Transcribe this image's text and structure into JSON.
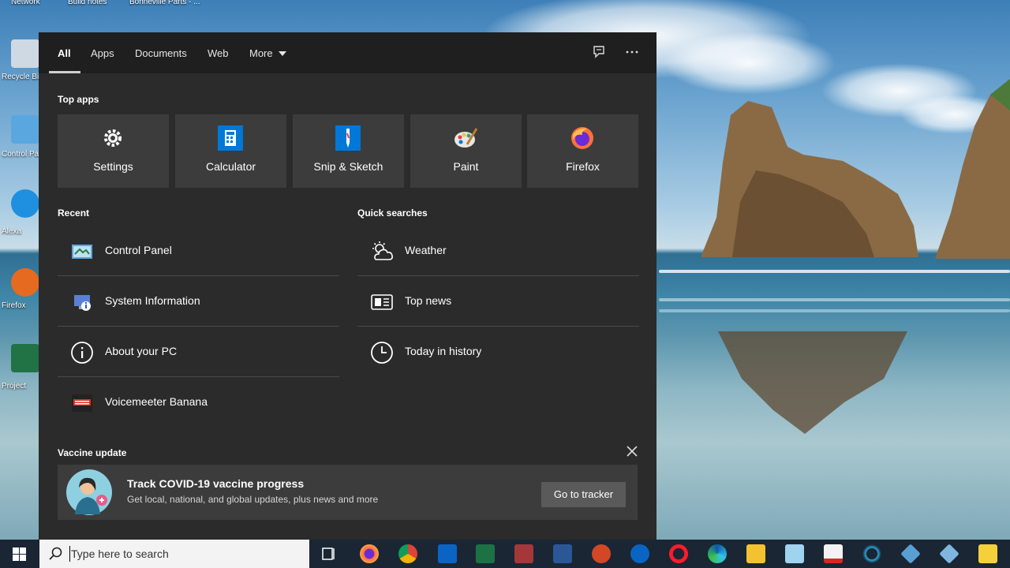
{
  "desktop": {
    "top_labels": [
      "Network",
      "Build notes",
      "Bonneville Parts - ..."
    ],
    "icons": [
      {
        "name": "recycle-bin",
        "label": "Recycle Bin"
      },
      {
        "name": "control-panel",
        "label": "Control Panel"
      },
      {
        "name": "alexa",
        "label": "Alexa"
      },
      {
        "name": "firefox",
        "label": "Firefox"
      },
      {
        "name": "project",
        "label": "Project"
      }
    ]
  },
  "search_panel": {
    "tabs": [
      {
        "label": "All",
        "active": true
      },
      {
        "label": "Apps"
      },
      {
        "label": "Documents"
      },
      {
        "label": "Web"
      },
      {
        "label": "More"
      }
    ],
    "top_apps_title": "Top apps",
    "top_apps": [
      {
        "label": "Settings",
        "icon": "gear-icon"
      },
      {
        "label": "Calculator",
        "icon": "calculator-icon"
      },
      {
        "label": "Snip & Sketch",
        "icon": "snip-sketch-icon"
      },
      {
        "label": "Paint",
        "icon": "paint-icon"
      },
      {
        "label": "Firefox",
        "icon": "firefox-icon"
      }
    ],
    "recent_title": "Recent",
    "recent": [
      {
        "label": "Control Panel",
        "icon": "control-panel-icon"
      },
      {
        "label": "System Information",
        "icon": "system-info-icon"
      },
      {
        "label": "About your PC",
        "icon": "info-circle-icon"
      },
      {
        "label": "Voicemeeter Banana",
        "icon": "voicemeeter-icon"
      }
    ],
    "quick_title": "Quick searches",
    "quick": [
      {
        "label": "Weather",
        "icon": "weather-icon"
      },
      {
        "label": "Top news",
        "icon": "news-icon"
      },
      {
        "label": "Today in history",
        "icon": "clock-icon"
      }
    ],
    "vaccine": {
      "section_title": "Vaccine update",
      "title": "Track COVID-19 vaccine progress",
      "description": "Get local, national, and global updates, plus news and more",
      "button": "Go to tracker"
    }
  },
  "taskbar": {
    "search_placeholder": "Type here to search",
    "apps": [
      "task-view",
      "firefox",
      "chrome",
      "outlook",
      "excel",
      "access",
      "word",
      "powerpoint",
      "onedrive",
      "opera",
      "edge",
      "file-explorer",
      "notepad",
      "acrobat",
      "unknown",
      "remote-desktop",
      "network",
      "sticky-notes"
    ]
  },
  "colors": {
    "panel_bg": "#2b2b2b",
    "tile_bg": "#3c3c3c",
    "taskbar_bg": "#1a2633",
    "accent_blue": "#0078d7"
  }
}
